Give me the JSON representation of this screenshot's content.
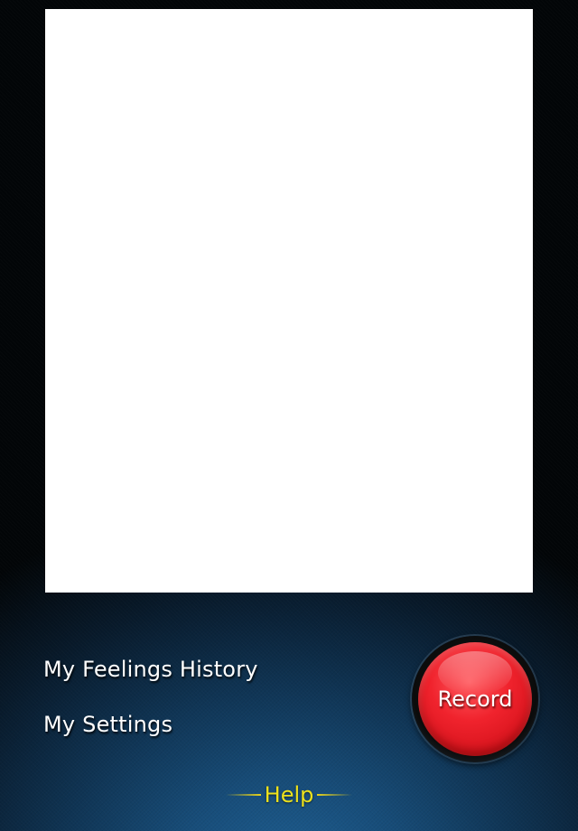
{
  "menu": {
    "history_label": "My Feelings History",
    "settings_label": "My Settings"
  },
  "record": {
    "label": "Record"
  },
  "help": {
    "label": "Help"
  },
  "colors": {
    "record_red": "#f0232d",
    "help_yellow": "#ece11c",
    "background_blue": "#1e5f93",
    "content_panel": "#ffffff"
  }
}
